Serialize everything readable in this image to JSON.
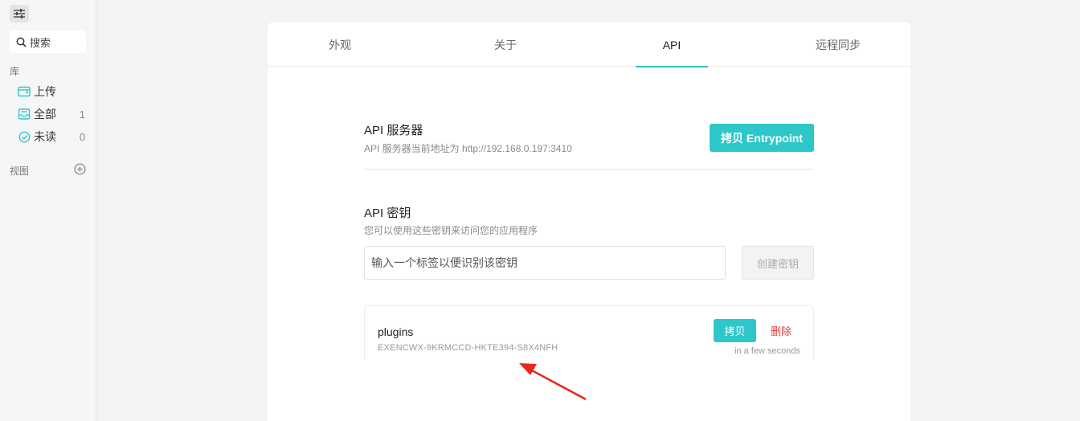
{
  "sidebar": {
    "search_label": "搜索",
    "library_label": "库",
    "items": [
      {
        "label": "上传",
        "count": ""
      },
      {
        "label": "全部",
        "count": "1"
      },
      {
        "label": "未读",
        "count": "0"
      }
    ],
    "views_label": "视图"
  },
  "tabs": [
    {
      "label": "外观"
    },
    {
      "label": "关于"
    },
    {
      "label": "API",
      "active": true
    },
    {
      "label": "远程同步"
    }
  ],
  "api_server": {
    "title": "API 服务器",
    "description": "API 服务器当前地址为 http://192.168.0.197:3410",
    "copy_button": "拷贝 Entrypoint"
  },
  "api_keys": {
    "title": "API 密钥",
    "description": "您可以使用这些密钥来访问您的应用程序",
    "input_placeholder": "输入一个标签以便识别该密钥",
    "create_button": "创建密钥",
    "keys": [
      {
        "name": "plugins",
        "value": "EXENCWX-9KRMCCD-HKTE394-S8X4NFH",
        "copy_label": "拷贝",
        "delete_label": "删除",
        "time": "in a few seconds"
      }
    ]
  },
  "colors": {
    "accent": "#2ec7c9",
    "danger": "#e03c3c",
    "annotation_arrow": "#e8281e"
  }
}
